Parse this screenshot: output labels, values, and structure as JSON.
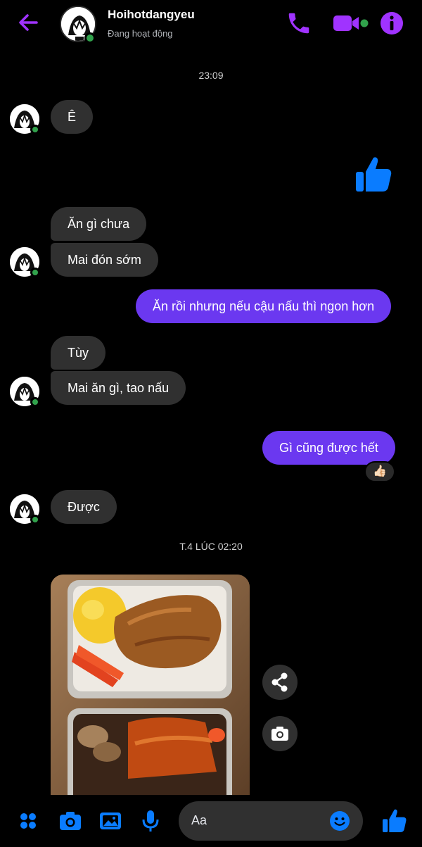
{
  "header": {
    "contact_name": "Hoihotdangyeu",
    "status": "Đang hoạt động",
    "accent": "#a033ff"
  },
  "messages": {
    "time_1": "23:09",
    "m1": "Ê",
    "m2": "Ăn gì chưa",
    "m3": "Mai đón sớm",
    "m4": "Ăn rồi nhưng nếu cậu nấu thì ngon hơn",
    "m5": "Tùy",
    "m6": "Mai ăn gì, tao nấu",
    "m7": "Gì cũng được hết",
    "m7_reaction": "👍🏻",
    "m8": "Được",
    "time_2": "T.4 LÚC 02:20"
  },
  "composer": {
    "placeholder": "Aa"
  },
  "icons": {
    "back": "back-arrow-icon",
    "call": "phone-icon",
    "video": "video-camera-icon",
    "info": "info-icon",
    "like": "thumbs-up-icon",
    "share": "share-icon",
    "camera": "camera-icon",
    "apps": "four-dots-icon",
    "gallery": "image-icon",
    "mic": "microphone-icon",
    "emoji": "smiley-icon"
  },
  "colors": {
    "outgoing_bubble": "#6b38f0",
    "incoming_bubble": "#303030",
    "like_blue": "#0a7cff",
    "online_green": "#31a24c"
  }
}
